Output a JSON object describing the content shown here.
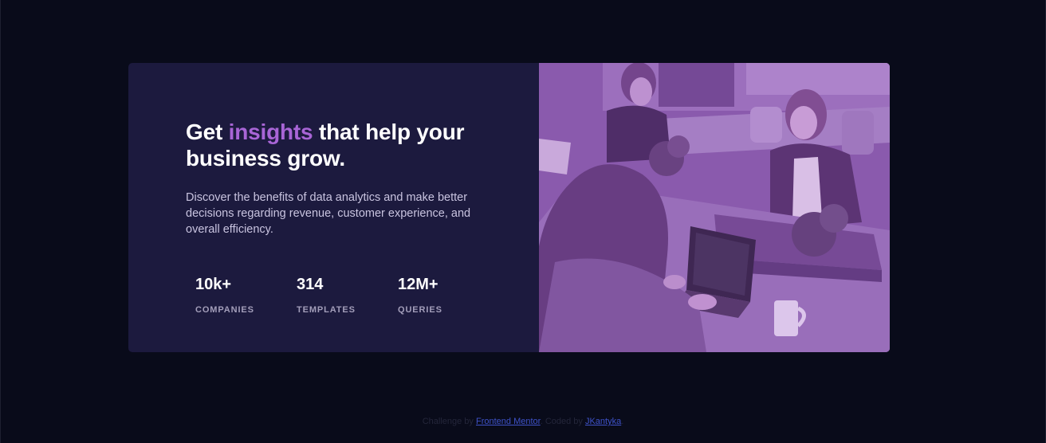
{
  "headline": {
    "before": "Get ",
    "accent": "insights",
    "after": " that help your business grow."
  },
  "description": "Discover the benefits of data analytics and make better decisions regarding revenue, customer experience, and overall efficiency.",
  "stats": [
    {
      "value": "10k+",
      "label": "COMPANIES"
    },
    {
      "value": "314",
      "label": "TEMPLATES"
    },
    {
      "value": "12M+",
      "label": "QUERIES"
    }
  ],
  "image": {
    "alt": "Team working together in an office"
  },
  "attribution": {
    "prefix": "Challenge by ",
    "link1": "Frontend Mentor",
    "middle": ". Coded by ",
    "link2": "JKantyka",
    "suffix": "."
  },
  "colors": {
    "page_bg": "#090b1a",
    "card_bg": "#1c1a3e",
    "accent": "#a865d6",
    "image_overlay": "#8a5aa7",
    "link": "#3e52c8"
  }
}
